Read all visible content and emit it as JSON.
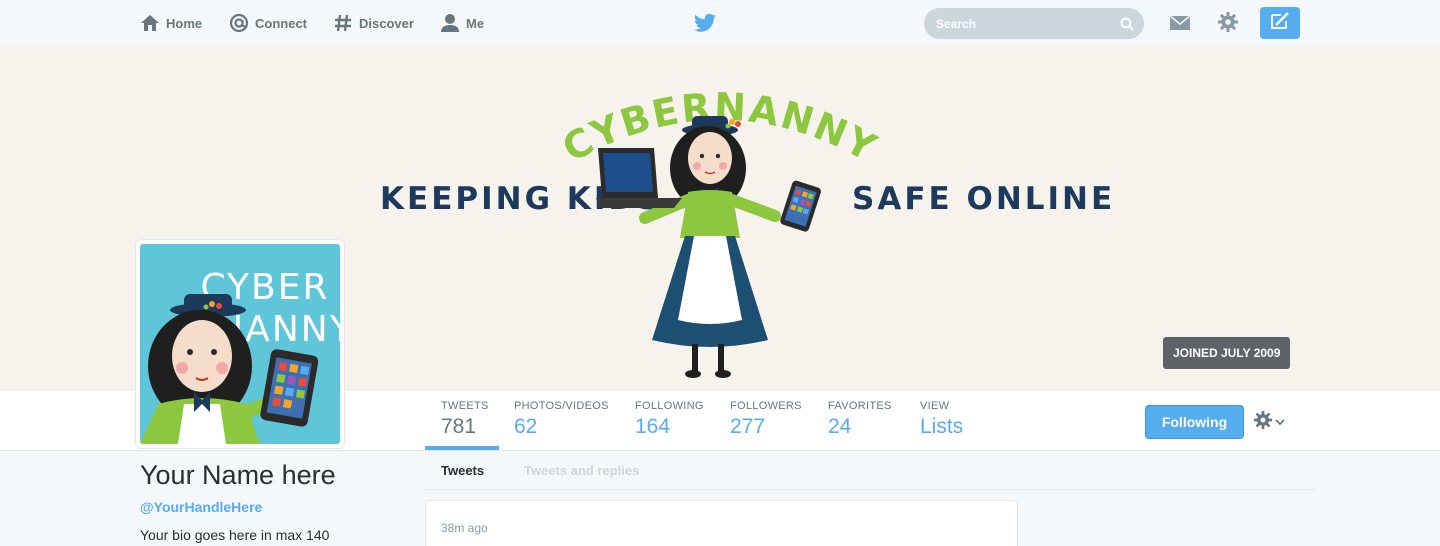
{
  "nav": {
    "home": "Home",
    "connect": "Connect",
    "discover": "Discover",
    "me": "Me",
    "search_placeholder": "Search",
    "icons": [
      "home-icon",
      "at-icon",
      "hashtag-icon",
      "person-icon",
      "twitter-bird-icon",
      "search-icon",
      "envelope-icon",
      "gear-icon",
      "compose-icon"
    ]
  },
  "banner": {
    "logo_text": "CYBERNANNY",
    "tagline_left": "KEEPING KIDS",
    "tagline_right": "SAFE ONLINE",
    "joined": "JOINED JULY 2009"
  },
  "avatar": {
    "line1": "CYBER",
    "line2": "NANNY"
  },
  "profile": {
    "name": "Your Name here",
    "handle": "@YourHandleHere",
    "bio": "Your bio goes here in max 140"
  },
  "stats": [
    {
      "label": "TWEETS",
      "value": "781"
    },
    {
      "label": "PHOTOS/VIDEOS",
      "value": "62"
    },
    {
      "label": "FOLLOWING",
      "value": "164"
    },
    {
      "label": "FOLLOWERS",
      "value": "277"
    },
    {
      "label": "FAVORITES",
      "value": "24"
    },
    {
      "label": "VIEW",
      "value": "Lists"
    }
  ],
  "actions": {
    "following": "Following"
  },
  "tabs": {
    "tweets": "Tweets",
    "replies": "Tweets and replies"
  },
  "tweet": {
    "time": "38m ago"
  },
  "colors": {
    "accent": "#55acee",
    "banner_bg": "#f6f3ec",
    "nanny_green": "#8dc63f",
    "navy": "#1d3a5c",
    "avatar_bg": "#5ec6d8"
  }
}
